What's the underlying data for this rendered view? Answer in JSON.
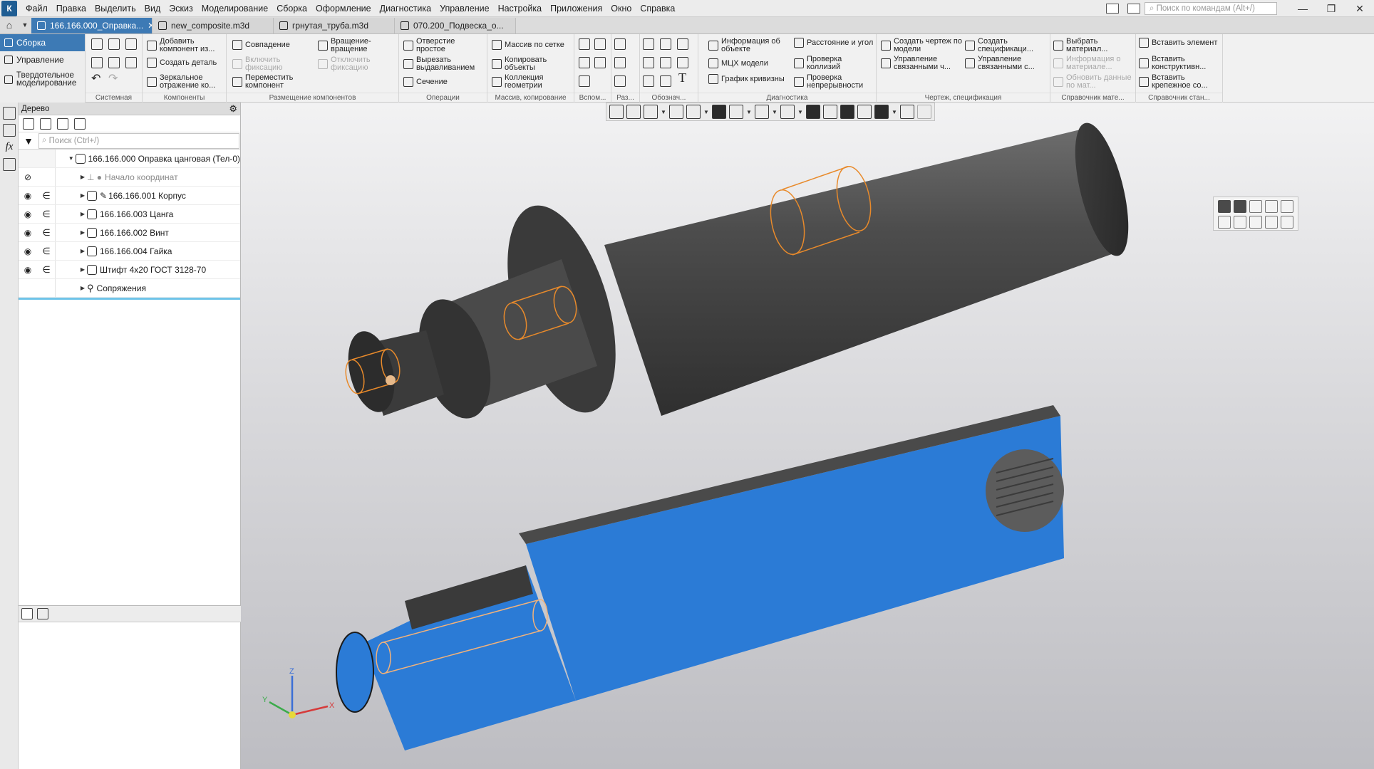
{
  "menu": [
    "Файл",
    "Правка",
    "Выделить",
    "Вид",
    "Эскиз",
    "Моделирование",
    "Сборка",
    "Оформление",
    "Диагностика",
    "Управление",
    "Настройка",
    "Приложения",
    "Окно",
    "Справка"
  ],
  "command_search_placeholder": "Поиск по командам (Alt+/)",
  "tabs": [
    {
      "label": "166.166.000_Оправка...",
      "active": true
    },
    {
      "label": "new_composite.m3d",
      "active": false
    },
    {
      "label": "грнутая_труба.m3d",
      "active": false
    },
    {
      "label": "070.200_Подвеска_о...",
      "active": false
    }
  ],
  "left_nav": [
    "Сборка",
    "Управление",
    "Твердотельное моделирование"
  ],
  "ribbon": {
    "groups": [
      "Системная",
      "Компоненты",
      "Размещение компонентов",
      "Операции",
      "Массив, копирование",
      "Вспом...",
      "Раз...",
      "Обознач...",
      "Диагностика",
      "Чертеж, спецификация",
      "Справочник мате...",
      "Справочник стан..."
    ],
    "komponenty": [
      "Добавить компонент из...",
      "Создать деталь",
      "Зеркальное отражение ко..."
    ],
    "razmeshchenie": [
      "Совпадение",
      "Вращение-вращение",
      "Включить фиксацию",
      "Отключить фиксацию",
      "Переместить компонент"
    ],
    "operatsii": [
      "Отверстие простое",
      "Вырезать выдавливанием",
      "Сечение"
    ],
    "massiv": [
      "Массив по сетке",
      "Копировать объекты",
      "Коллекция геометрии"
    ],
    "diagnostika": [
      "Информация об объекте",
      "МЦХ модели",
      "График кривизны",
      "Расстояние и угол",
      "Проверка коллизий",
      "Проверка непрерывности"
    ],
    "chertezh": [
      "Создать чертеж по модели",
      "Управление связанными ч...",
      "Создать спецификаци...",
      "Управление связанными с..."
    ],
    "material": [
      "Выбрать материал...",
      "Информация о материале...",
      "Обновить данные по мат..."
    ],
    "standart": [
      "Вставить элемент",
      "Вставить конструктивн...",
      "Вставить крепежное со..."
    ]
  },
  "tree": {
    "title": "Дерево",
    "search_placeholder": "Поиск (Ctrl+/)",
    "items": [
      {
        "label": "166.166.000 Оправка цанговая (Тел-0)",
        "indent": 0
      },
      {
        "label": "Начало координат",
        "indent": 1
      },
      {
        "label": "166.166.001 Корпус",
        "indent": 1
      },
      {
        "label": "166.166.003 Цанга",
        "indent": 1
      },
      {
        "label": "166.166.002 Винт",
        "indent": 1
      },
      {
        "label": "166.166.004 Гайка",
        "indent": 1
      },
      {
        "label": "Штифт 4х20 ГОСТ 3128-70",
        "indent": 1
      },
      {
        "label": "Сопряжения",
        "indent": 1
      }
    ]
  },
  "axes": {
    "x": "X",
    "y": "Y",
    "z": "Z"
  },
  "colors": {
    "accent": "#3d7ab5",
    "section_fill": "#2b7bd6",
    "model_gray": "#4b4b4b",
    "highlight_edges": "#e88a2b"
  }
}
